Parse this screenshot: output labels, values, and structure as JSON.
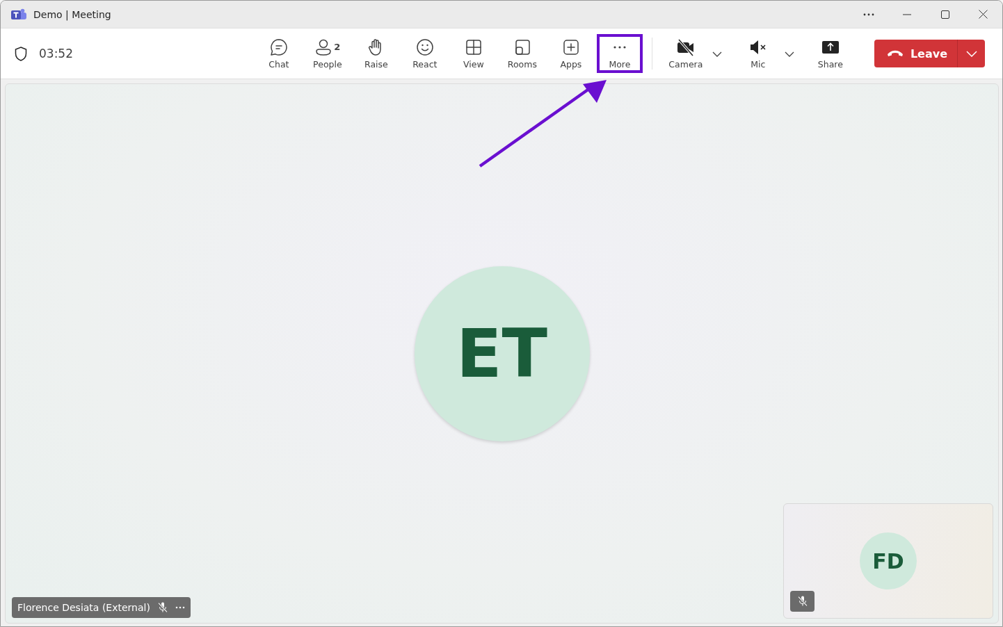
{
  "window": {
    "title": "Demo | Meeting"
  },
  "meeting": {
    "timer": "03:52"
  },
  "toolbar": [
    {
      "label": "Chat",
      "highlighted": false,
      "dropdown": false
    },
    {
      "label": "People",
      "badge": "2",
      "highlighted": false,
      "dropdown": false
    },
    {
      "label": "Raise",
      "highlighted": false,
      "dropdown": false
    },
    {
      "label": "React",
      "highlighted": false,
      "dropdown": false
    },
    {
      "label": "View",
      "highlighted": false,
      "dropdown": false
    },
    {
      "label": "Rooms",
      "highlighted": false,
      "dropdown": false
    },
    {
      "label": "Apps",
      "highlighted": false,
      "dropdown": false
    },
    {
      "label": "More",
      "highlighted": true,
      "pointer_arrow": true,
      "dropdown": false
    },
    {
      "label": "Camera",
      "highlighted": false,
      "dropdown": true
    },
    {
      "label": "Mic",
      "highlighted": false,
      "dropdown": true
    },
    {
      "label": "Share",
      "highlighted": false,
      "dropdown": false
    }
  ],
  "leave": {
    "label": "Leave"
  },
  "main_participant": {
    "initials": "ET",
    "name": "Florence Desiata (External)",
    "muted": true
  },
  "self_view": {
    "initials": "FD",
    "muted": true
  }
}
